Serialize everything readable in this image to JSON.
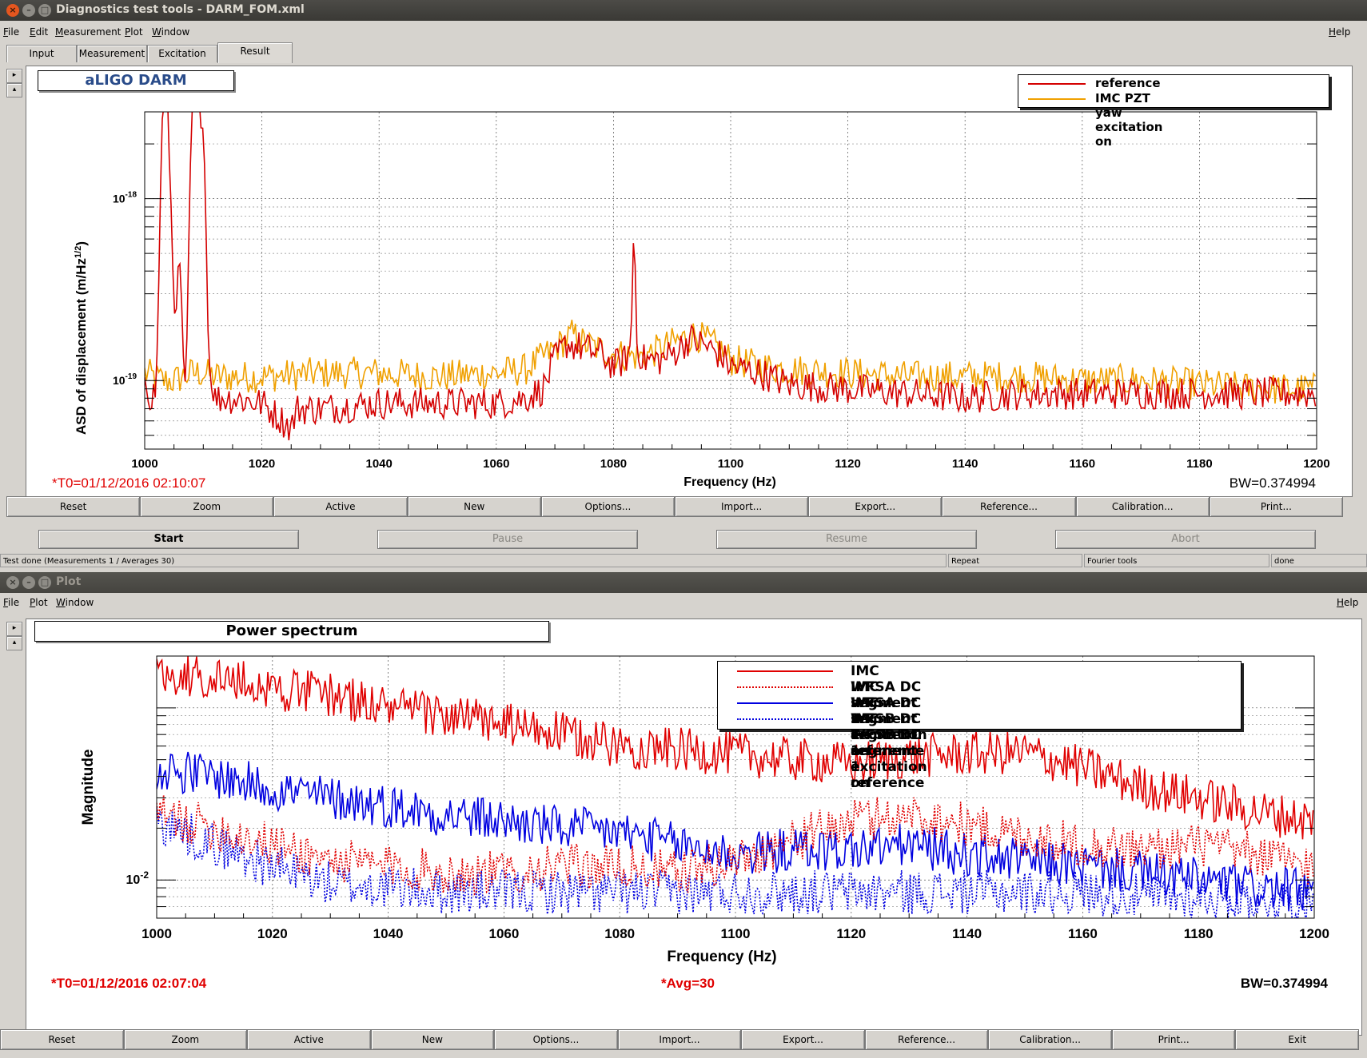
{
  "win1": {
    "title": "Diagnostics test tools - DARM_FOM.xml",
    "menu": [
      "File",
      "Edit",
      "Measurement",
      "Plot",
      "Window"
    ],
    "help": "Help",
    "tabs": [
      "Input",
      "Measurement",
      "Excitation",
      "Result"
    ],
    "plot_title": "aLIGO DARM",
    "t0": "*T0=01/12/2016 02:10:07",
    "bw": "BW=0.374994",
    "buttons": [
      "Reset",
      "Zoom",
      "Active",
      "New",
      "Options...",
      "Import...",
      "Export...",
      "Reference...",
      "Calibration...",
      "Print..."
    ],
    "controls": [
      "Start",
      "Pause",
      "Resume",
      "Abort"
    ],
    "status": {
      "left": "Test done (Measurements 1 / Averages 30)",
      "repeat": "Repeat",
      "tools": "Fourier tools",
      "state": "done"
    }
  },
  "win2": {
    "title": "Plot",
    "menu": [
      "File",
      "Plot",
      "Window"
    ],
    "help": "Help",
    "plot_title": "Power spectrum",
    "t0": "*T0=01/12/2016 02:07:04",
    "avg": "*Avg=30",
    "bw": "BW=0.374994",
    "buttons": [
      "Reset",
      "Zoom",
      "Active",
      "New",
      "Options...",
      "Import...",
      "Export...",
      "Reference...",
      "Calibration...",
      "Print...",
      "Exit"
    ]
  },
  "chart_data": [
    {
      "type": "line",
      "title": "aLIGO DARM",
      "xlabel": "Frequency (Hz)",
      "ylabel": "ASD of displacement (m/Hz^1/2)",
      "xlim": [
        1000,
        1200
      ],
      "ylim": [
        4.2e-20,
        3e-18
      ],
      "yscale": "log",
      "grid": true,
      "legend_position": "top-right",
      "x_ticks": [
        1000,
        1020,
        1040,
        1060,
        1080,
        1100,
        1120,
        1140,
        1160,
        1180,
        1200
      ],
      "y_tick_labels": [
        {
          "base": "10",
          "exp": "-18",
          "value": 1e-18
        },
        {
          "base": "10",
          "exp": "-19",
          "value": 1e-19
        }
      ],
      "series": [
        {
          "name": "reference",
          "color": "#d40000",
          "style": "solid",
          "x": [
            1000,
            1001,
            1002,
            1003,
            1004,
            1005,
            1006,
            1007,
            1008,
            1009,
            1010,
            1011,
            1012,
            1015,
            1020,
            1025,
            1026,
            1030,
            1040,
            1050,
            1060,
            1065,
            1068,
            1070,
            1072,
            1075,
            1078,
            1080,
            1082,
            1083,
            1083.5,
            1084,
            1085,
            1088,
            1090,
            1093,
            1095,
            1098,
            1100,
            1105,
            1110,
            1120,
            1130,
            1140,
            1150,
            1160,
            1170,
            1180,
            1190,
            1195,
            1200
          ],
          "y": [
            1.1e-19,
            8e-20,
            9e-20,
            3e-18,
            3e-18,
            2.5e-19,
            4e-19,
            7e-20,
            3e-18,
            3e-18,
            3e-18,
            1.2e-19,
            8e-20,
            8e-20,
            7.5e-20,
            5.5e-20,
            7e-20,
            7e-20,
            7.5e-20,
            7.5e-20,
            7.5e-20,
            8e-20,
            9e-20,
            1.3e-19,
            1.6e-19,
            1.5e-19,
            1.4e-19,
            1.2e-19,
            1.3e-19,
            1.5e-19,
            8.5e-19,
            1.6e-19,
            1.3e-19,
            1.3e-19,
            1.4e-19,
            1.7e-19,
            1.6e-19,
            1.4e-19,
            1.2e-19,
            1.1e-19,
            9.5e-20,
            9e-20,
            8.5e-20,
            8e-20,
            8.5e-20,
            8.5e-20,
            8.5e-20,
            8.5e-20,
            8.5e-20,
            8.5e-20,
            8.5e-20
          ]
        },
        {
          "name": "IMC PZT yaw excitation on",
          "color": "#f0a000",
          "style": "solid",
          "x": [
            1000,
            1003,
            1005,
            1008,
            1010,
            1012,
            1020,
            1030,
            1040,
            1050,
            1060,
            1065,
            1070,
            1073,
            1075,
            1080,
            1085,
            1090,
            1094,
            1098,
            1100,
            1105,
            1110,
            1120,
            1130,
            1140,
            1150,
            1160,
            1170,
            1180,
            1190,
            1200
          ],
          "y": [
            1.1e-19,
            1e-19,
            1e-19,
            1.1e-19,
            1.1e-19,
            1.05e-19,
            1.05e-19,
            1.1e-19,
            1.1e-19,
            1.05e-19,
            1.1e-19,
            1.15e-19,
            1.5e-19,
            1.8e-19,
            1.6e-19,
            1.4e-19,
            1.35e-19,
            1.6e-19,
            1.8e-19,
            1.5e-19,
            1.3e-19,
            1.2e-19,
            1.15e-19,
            1.1e-19,
            1.05e-19,
            1.05e-19,
            1.05e-19,
            1e-19,
            1e-19,
            9.5e-20,
            9e-20,
            9e-20
          ]
        }
      ]
    },
    {
      "type": "line",
      "title": "Power spectrum",
      "xlabel": "Frequency (Hz)",
      "ylabel": "Magnitude",
      "xlim": [
        1000,
        1200
      ],
      "ylim": [
        0.006,
        0.2
      ],
      "yscale": "log",
      "grid": true,
      "legend_position": "top-right",
      "x_ticks": [
        1000,
        1020,
        1040,
        1060,
        1080,
        1100,
        1120,
        1140,
        1160,
        1180,
        1200
      ],
      "y_tick_labels": [
        {
          "base": "10",
          "exp": "-2",
          "value": 0.01
        }
      ],
      "series": [
        {
          "name": "IMC WFSA DC segment 1 excitation on",
          "color": "#e00000",
          "style": "solid",
          "x": [
            1000,
            1010,
            1020,
            1030,
            1040,
            1050,
            1060,
            1070,
            1080,
            1090,
            1100,
            1110,
            1120,
            1130,
            1140,
            1150,
            1160,
            1170,
            1180,
            1190,
            1200
          ],
          "y": [
            0.16,
            0.15,
            0.13,
            0.12,
            0.1,
            0.09,
            0.08,
            0.07,
            0.06,
            0.057,
            0.054,
            0.05,
            0.047,
            0.052,
            0.054,
            0.055,
            0.045,
            0.035,
            0.03,
            0.025,
            0.022
          ]
        },
        {
          "name": "IMC WFSA DC segment 1 reference",
          "color": "#e00000",
          "style": "dotted",
          "x": [
            1000,
            1010,
            1020,
            1030,
            1040,
            1050,
            1060,
            1070,
            1080,
            1090,
            1100,
            1110,
            1120,
            1130,
            1140,
            1150,
            1160,
            1170,
            1180,
            1190,
            1200
          ],
          "y": [
            0.024,
            0.02,
            0.016,
            0.013,
            0.012,
            0.011,
            0.011,
            0.012,
            0.012,
            0.011,
            0.013,
            0.017,
            0.022,
            0.024,
            0.021,
            0.018,
            0.016,
            0.015,
            0.016,
            0.014,
            0.012
          ]
        },
        {
          "name": "IMC WFSB DC segment 1 excitation on",
          "color": "#0000e0",
          "style": "solid",
          "x": [
            1000,
            1010,
            1020,
            1030,
            1040,
            1050,
            1060,
            1070,
            1080,
            1090,
            1100,
            1110,
            1120,
            1130,
            1140,
            1150,
            1160,
            1170,
            1180,
            1190,
            1200
          ],
          "y": [
            0.045,
            0.04,
            0.034,
            0.03,
            0.027,
            0.024,
            0.022,
            0.02,
            0.019,
            0.016,
            0.014,
            0.015,
            0.015,
            0.016,
            0.014,
            0.013,
            0.012,
            0.011,
            0.01,
            0.009,
            0.0085
          ]
        },
        {
          "name": "IMC WFSB DC segment 1 reference",
          "color": "#0000e0",
          "style": "dotted",
          "x": [
            1000,
            1010,
            1020,
            1030,
            1040,
            1050,
            1060,
            1070,
            1080,
            1090,
            1100,
            1110,
            1120,
            1130,
            1140,
            1150,
            1160,
            1170,
            1180,
            1190,
            1200
          ],
          "y": [
            0.022,
            0.016,
            0.012,
            0.0095,
            0.009,
            0.0085,
            0.0085,
            0.0085,
            0.0085,
            0.0085,
            0.0085,
            0.0085,
            0.0085,
            0.0085,
            0.0085,
            0.0085,
            0.0085,
            0.008,
            0.008,
            0.0078,
            0.0075
          ]
        }
      ]
    }
  ]
}
